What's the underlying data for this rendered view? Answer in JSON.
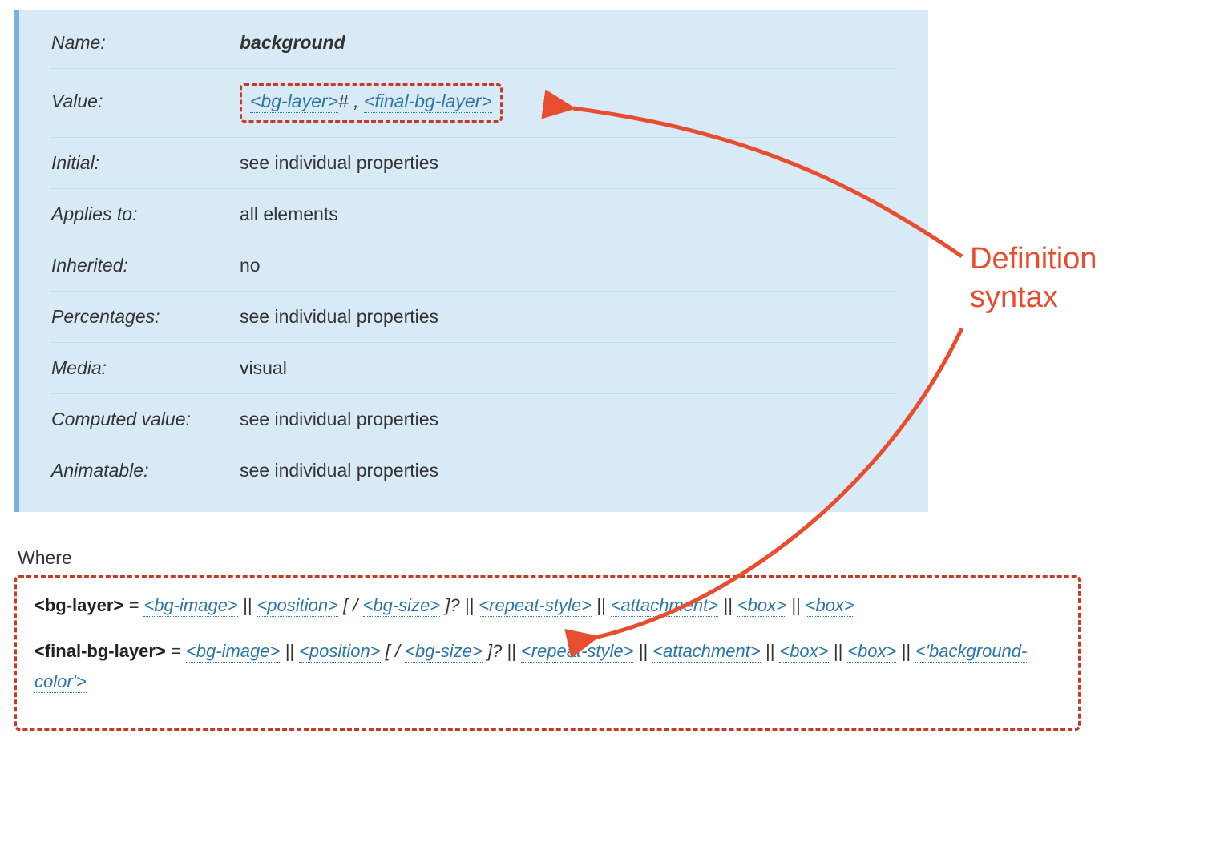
{
  "annotation": {
    "label_line1": "Definition",
    "label_line2": "syntax"
  },
  "colors": {
    "accent": "#e84d30",
    "link": "#2a77a7",
    "panel_bg": "#d9eaf7",
    "panel_border": "#7fb1d8",
    "highlight_border": "#c53b27"
  },
  "property_table": {
    "rows": [
      {
        "label": "Name:",
        "value": "background",
        "bold": true,
        "is_syntax": false
      },
      {
        "label": "Value:",
        "is_syntax": true,
        "syntax": [
          {
            "t": "link",
            "text": "<bg-layer>"
          },
          {
            "t": "plain",
            "text": "# , "
          },
          {
            "t": "link",
            "text": "<final-bg-layer>"
          }
        ]
      },
      {
        "label": "Initial:",
        "value": "see individual properties"
      },
      {
        "label": "Applies to:",
        "value": "all elements"
      },
      {
        "label": "Inherited:",
        "value": "no"
      },
      {
        "label": "Percentages:",
        "value": "see individual properties"
      },
      {
        "label": "Media:",
        "value": "visual"
      },
      {
        "label": "Computed value:",
        "value": "see individual properties"
      },
      {
        "label": "Animatable:",
        "value": "see individual properties"
      }
    ]
  },
  "where_label": "Where",
  "definitions": [
    {
      "term": "<bg-layer>",
      "tokens": [
        {
          "t": "plain",
          "text": " = "
        },
        {
          "t": "link",
          "text": "<bg-image>"
        },
        {
          "t": "plain",
          "text": " || "
        },
        {
          "t": "link",
          "text": "<position>"
        },
        {
          "t": "plain",
          "text": " [ / "
        },
        {
          "t": "link",
          "text": "<bg-size>"
        },
        {
          "t": "plain",
          "text": " ]? || "
        },
        {
          "t": "link",
          "text": "<repeat-style>"
        },
        {
          "t": "plain",
          "text": " || "
        },
        {
          "t": "link",
          "text": "<attachment>"
        },
        {
          "t": "plain",
          "text": " || "
        },
        {
          "t": "link",
          "text": "<box>"
        },
        {
          "t": "plain",
          "text": " || "
        },
        {
          "t": "link",
          "text": "<box>"
        }
      ]
    },
    {
      "term": "<final-bg-layer>",
      "tokens": [
        {
          "t": "plain",
          "text": " = "
        },
        {
          "t": "link",
          "text": "<bg-image>"
        },
        {
          "t": "plain",
          "text": " || "
        },
        {
          "t": "link",
          "text": "<position>"
        },
        {
          "t": "plain",
          "text": " [ / "
        },
        {
          "t": "link",
          "text": "<bg-size>"
        },
        {
          "t": "plain",
          "text": " ]? || "
        },
        {
          "t": "link",
          "text": "<repeat-style>"
        },
        {
          "t": "plain",
          "text": " || "
        },
        {
          "t": "link",
          "text": "<attachment>"
        },
        {
          "t": "plain",
          "text": " || "
        },
        {
          "t": "link",
          "text": "<box>"
        },
        {
          "t": "plain",
          "text": " || "
        },
        {
          "t": "link",
          "text": "<box>"
        },
        {
          "t": "plain",
          "text": " || "
        },
        {
          "t": "link",
          "text": "<'background-color'>"
        }
      ]
    }
  ]
}
